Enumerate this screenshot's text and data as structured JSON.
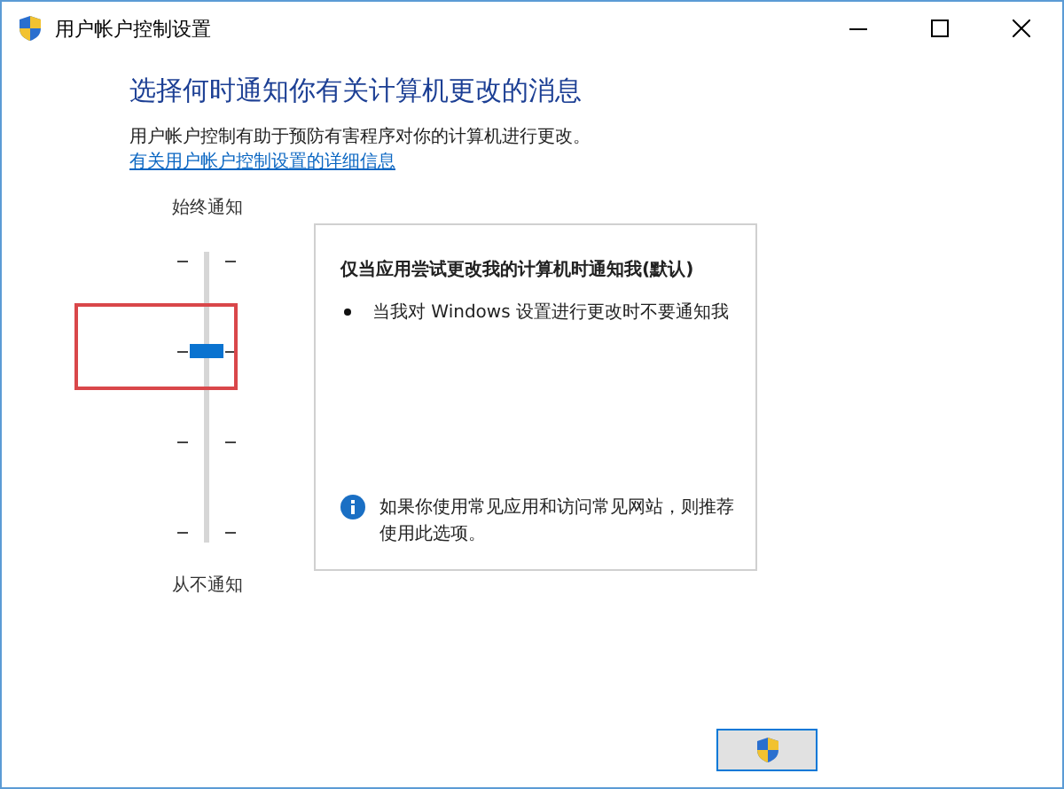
{
  "window": {
    "title": "用户帐户控制设置"
  },
  "heading": "选择何时通知你有关计算机更改的消息",
  "description": "用户帐户控制有助于预防有害程序对你的计算机进行更改。",
  "link": "有关用户帐户控制设置的详细信息",
  "slider": {
    "top_label": "始终通知",
    "bottom_label": "从不通知",
    "level": 0.667,
    "highlighted": true
  },
  "panel": {
    "title": "仅当应用尝试更改我的计算机时通知我(默认)",
    "bullets": [
      "当我对 Windows 设置进行更改时不要通知我"
    ],
    "note": "如果你使用常见应用和访问常见网站，则推荐使用此选项。"
  },
  "buttons": [
    {
      "kind": "shield"
    }
  ]
}
